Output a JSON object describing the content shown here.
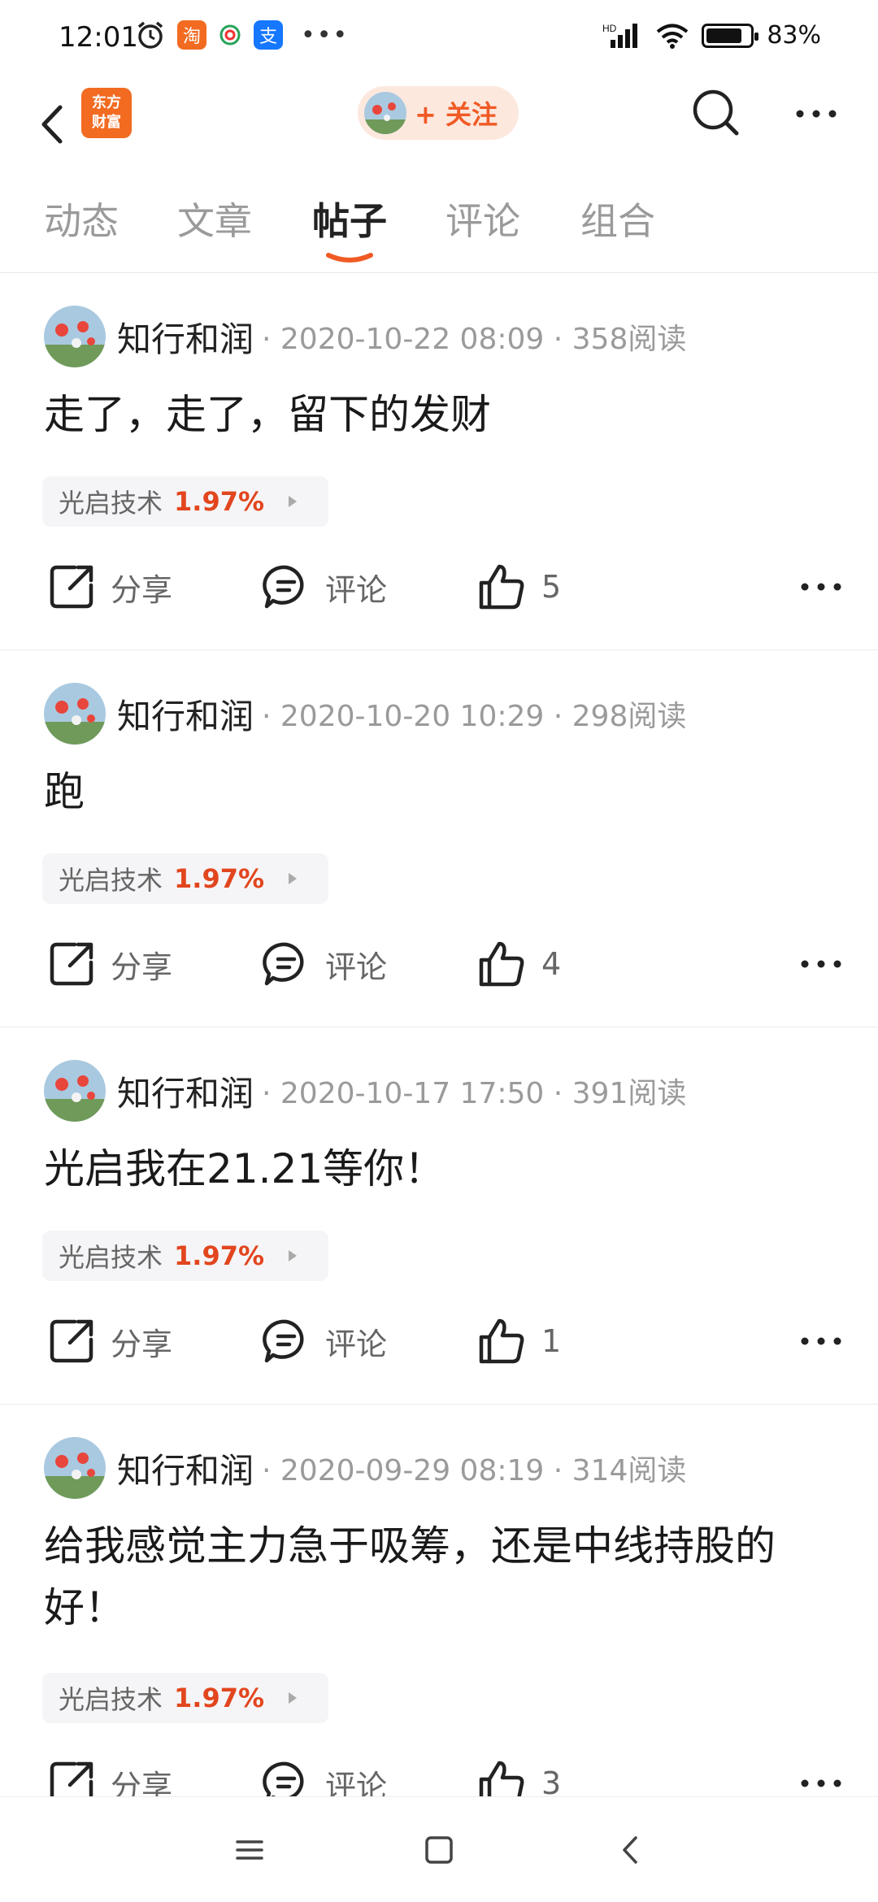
{
  "status_bar": {
    "time": "12:01",
    "apps": [
      "淘",
      "支"
    ],
    "network": "HD",
    "battery": "83%",
    "battery_level": 0.83
  },
  "nav": {
    "logo_line1": "东方",
    "logo_line2": "财富",
    "follow_label": "+ 关注"
  },
  "tabs": [
    "动态",
    "文章",
    "帖子",
    "评论",
    "组合"
  ],
  "active_tab": "帖子",
  "actions": {
    "share": "分享",
    "comment": "评论"
  },
  "posts": [
    {
      "author": "知行和润",
      "meta": "· 2020-10-22 08:09 · 358阅读",
      "text": "走了，走了，留下的发财",
      "stock_name": "光启技术",
      "stock_pct": "1.97%",
      "likes": "5"
    },
    {
      "author": "知行和润",
      "meta": "· 2020-10-20 10:29 · 298阅读",
      "text": "跑",
      "stock_name": "光启技术",
      "stock_pct": "1.97%",
      "likes": "4"
    },
    {
      "author": "知行和润",
      "meta": "· 2020-10-17 17:50 · 391阅读",
      "text": "光启我在21.21等你！",
      "stock_name": "光启技术",
      "stock_pct": "1.97%",
      "likes": "1"
    },
    {
      "author": "知行和润",
      "meta": "· 2020-09-29 08:19 · 314阅读",
      "text": "给我感觉主力急于吸筹，还是中线持股的好！",
      "stock_name": "光启技术",
      "stock_pct": "1.97%",
      "likes": "3"
    }
  ],
  "colors": {
    "accent": "#f05a24",
    "stock_up": "#e2461e"
  }
}
